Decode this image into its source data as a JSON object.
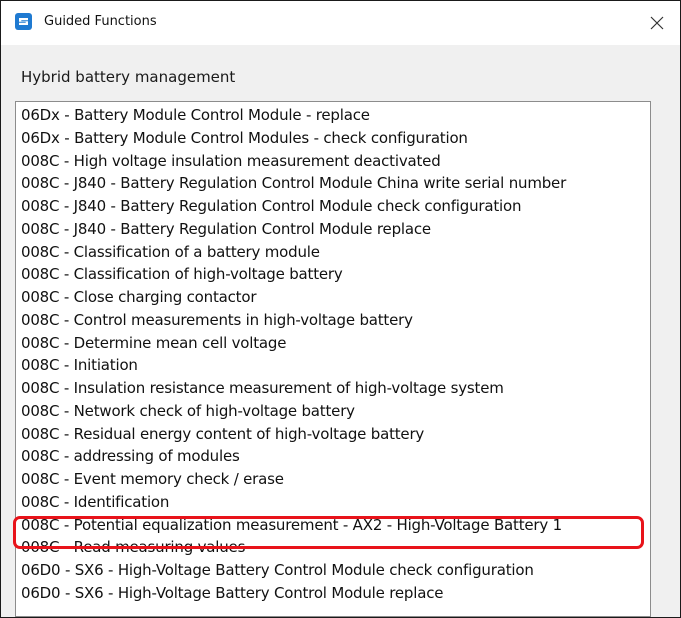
{
  "window": {
    "title": "Guided Functions",
    "app_icon": "app-logo-icon",
    "close_icon": "close-icon"
  },
  "section": {
    "label": "Hybrid battery management"
  },
  "functions_list": [
    "06Dx - Battery Module Control Module - replace",
    "06Dx - Battery Module Control Modules - check configuration",
    "008C -  High voltage insulation measurement  deactivated",
    "008C  -  J840 - Battery Regulation Control Module  China write serial number",
    "008C  -  J840 - Battery Regulation Control Module  check configuration",
    "008C  -  J840 - Battery Regulation Control Module  replace",
    "008C  - Classification of a battery module",
    "008C  - Classification of high-voltage battery",
    "008C  - Close charging contactor",
    "008C  - Control measurements in high-voltage battery",
    "008C  - Determine mean cell voltage",
    "008C  - Initiation",
    "008C  - Insulation resistance measurement of high-voltage system",
    "008C  - Network check of high-voltage battery",
    "008C  - Residual energy content of high-voltage battery",
    "008C  - addressing of modules",
    "008C - Event memory check / erase",
    "008C - Identification",
    "008C - Potential equalization measurement - AX2 - High-Voltage Battery 1",
    "008C - Read measuring values",
    "06D0  -  SX6 - High-Voltage Battery Control Module  check configuration",
    "06D0  -  SX6 - High-Voltage Battery Control Module  replace"
  ],
  "highlight": {
    "color": "#e8131a",
    "item_index": 18
  },
  "colors": {
    "app_icon": "#1f7ad1",
    "window_bg": "#f0f0f0",
    "list_bg": "#ffffff"
  }
}
